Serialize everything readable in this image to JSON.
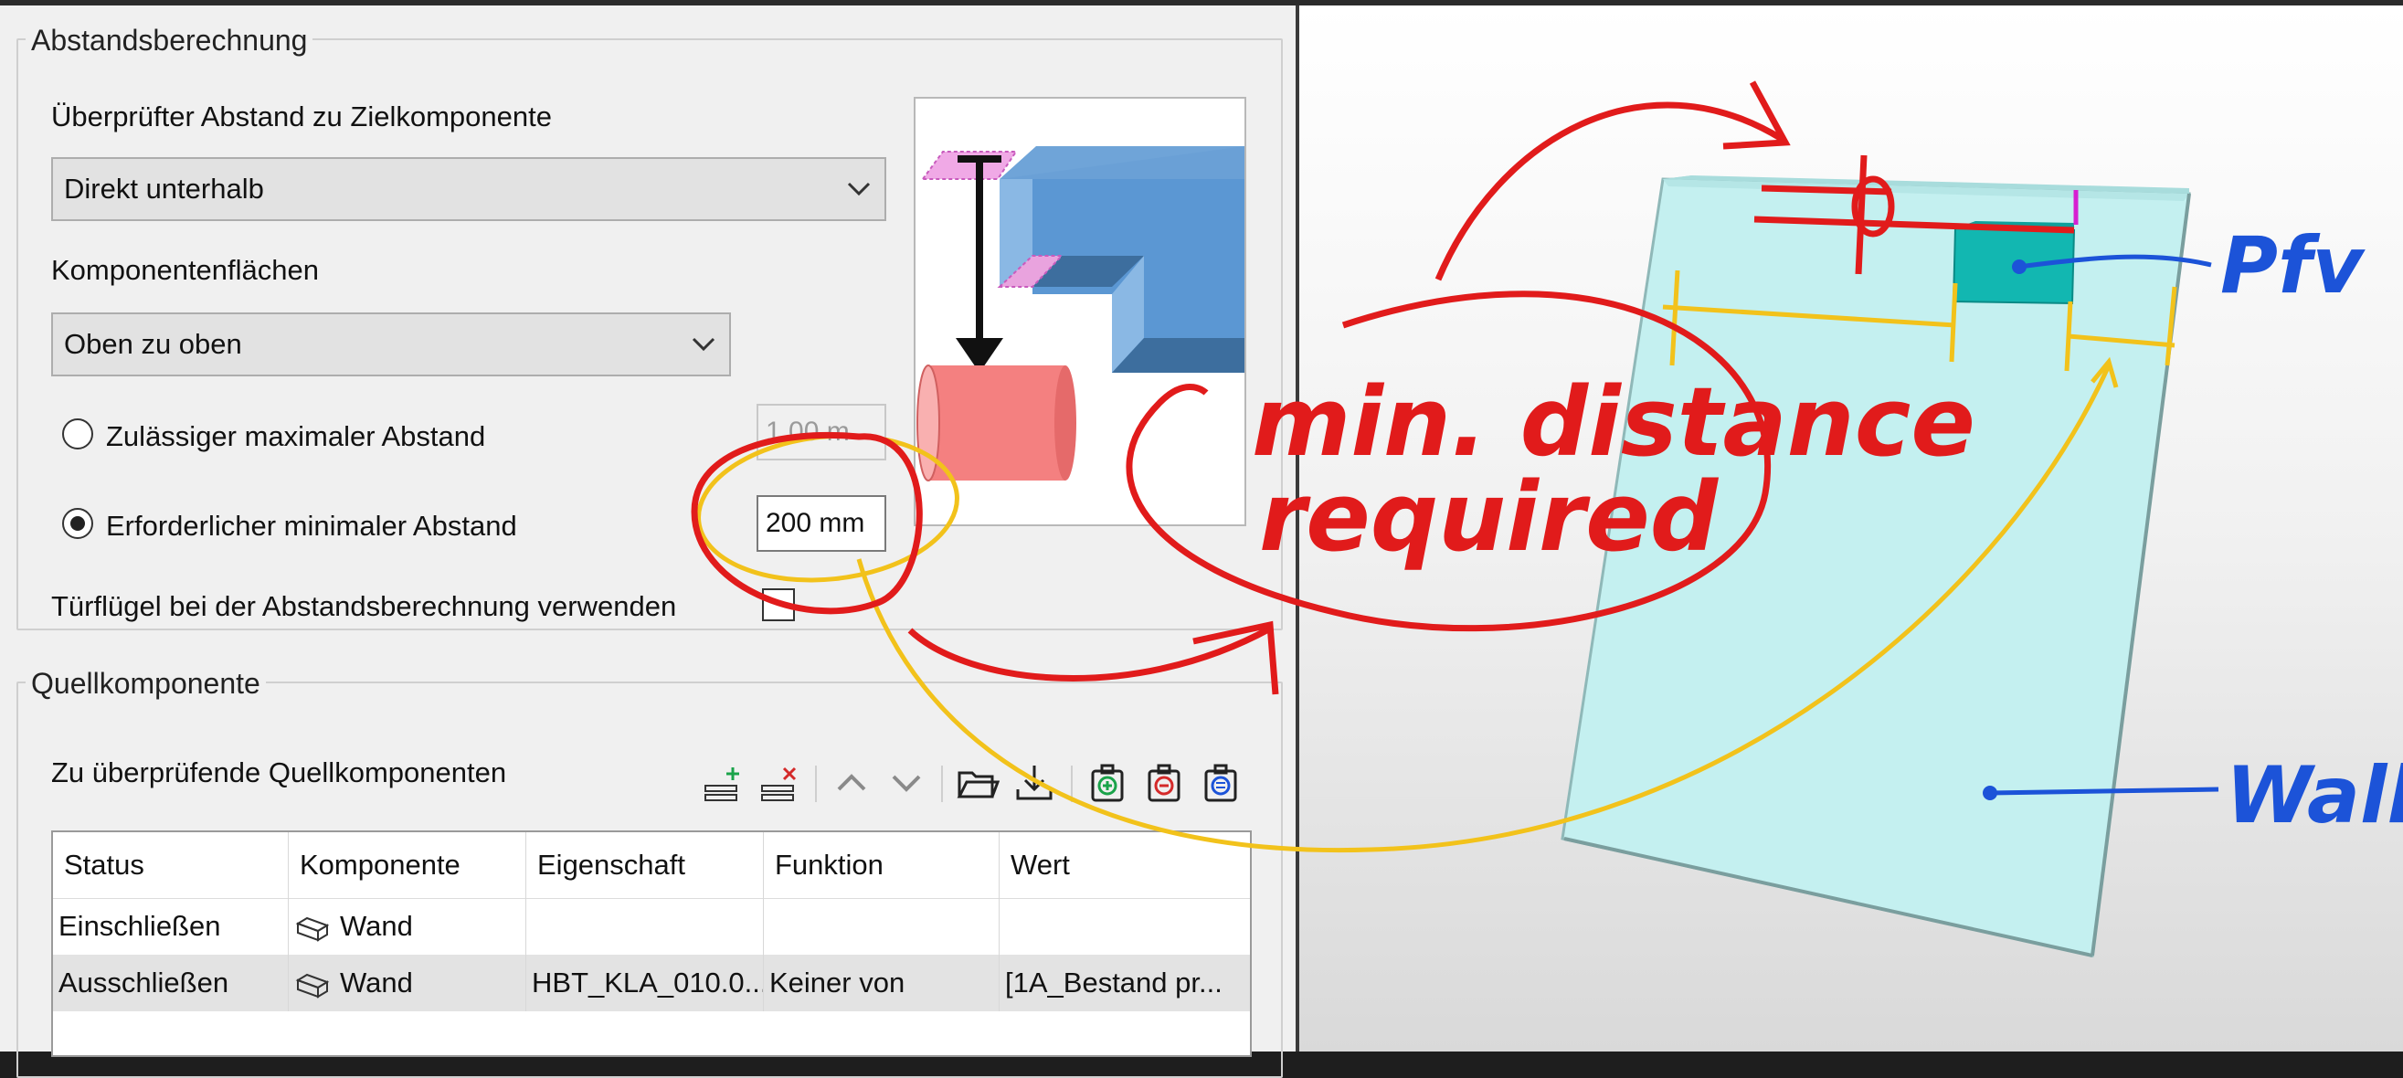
{
  "distance_group": {
    "title": "Abstandsberechnung",
    "checked_distance_label": "Überprüfter Abstand zu Zielkomponente",
    "checked_distance_value": "Direkt unterhalb",
    "faces_label": "Komponentenflächen",
    "faces_value": "Oben zu oben",
    "max_distance_label": "Zulässiger maximaler Abstand",
    "max_distance_value": "1.00 m",
    "min_distance_label": "Erforderlicher minimaler Abstand",
    "min_distance_value": "200 mm",
    "door_leaf_label": "Türflügel bei der Abstandsberechnung verwenden"
  },
  "source_group": {
    "title": "Quellkomponente",
    "list_label": "Zu überprüfende Quellkomponenten",
    "toolbar_icons": [
      "add-row-icon",
      "remove-row-icon",
      "move-up-icon",
      "move-down-icon",
      "open-folder-icon",
      "import-icon",
      "add-item-icon",
      "remove-item-icon",
      "clipboard-icon"
    ],
    "columns": [
      "Status",
      "Komponente",
      "Eigenschaft",
      "Funktion",
      "Wert"
    ],
    "rows": [
      {
        "status": "Einschließen",
        "component": "Wand",
        "property": "",
        "function": "",
        "value": ""
      },
      {
        "status": "Ausschließen",
        "component": "Wand",
        "property": "HBT_KLA_010.0...",
        "function": "Keiner von",
        "value": "[1A_Bestand pr..."
      }
    ]
  },
  "annotations": {
    "red_note_line1": "min. distance",
    "red_note_line2": "required",
    "blue_label_pfv": "Pfv",
    "blue_label_wall": "Wall"
  },
  "colors": {
    "red_ink": "#e11b1b",
    "yellow_ink": "#f2c21b",
    "blue_ink": "#1c53d8",
    "wall_fill": "#c4f0f0",
    "pfv_fill": "#12b7b1"
  }
}
